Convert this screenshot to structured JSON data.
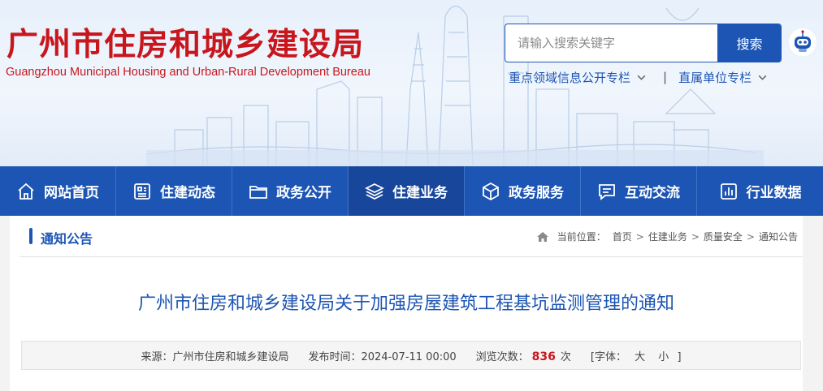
{
  "header": {
    "logo_cn": "广州市住房和城乡建设局",
    "logo_en": "Guangzhou Municipal Housing and Urban-Rural Development Bureau",
    "search_placeholder": "请输入搜索关键字",
    "search_button": "搜索",
    "sublinks": [
      "重点领域信息公开专栏",
      "直属单位专栏"
    ],
    "separator": "|",
    "robot_icon": "robot-assistant-icon"
  },
  "nav": {
    "items": [
      {
        "label": "网站首页",
        "icon": "home-icon"
      },
      {
        "label": "住建动态",
        "icon": "news-icon"
      },
      {
        "label": "政务公开",
        "icon": "folder-icon"
      },
      {
        "label": "住建业务",
        "icon": "layers-icon"
      },
      {
        "label": "政务服务",
        "icon": "box-icon"
      },
      {
        "label": "互动交流",
        "icon": "chat-icon"
      },
      {
        "label": "行业数据",
        "icon": "chart-icon"
      }
    ],
    "active_index": 3
  },
  "section": {
    "title": "通知公告",
    "breadcrumb_label": "当前位置：",
    "breadcrumb": [
      "首页",
      "住建业务",
      "质量安全",
      "通知公告"
    ],
    "breadcrumb_sep": ">"
  },
  "article": {
    "title": "广州市住房和城乡建设局关于加强房屋建筑工程基坑监测管理的通知",
    "source_label": "来源：",
    "source": "广州市住房和城乡建设局",
    "date_label": "发布时间：",
    "date": "2024-07-11 00:00",
    "views_label": "浏览次数：",
    "views": "836",
    "views_unit": "次",
    "font_open": "[字体：",
    "font_large": "大",
    "font_small": "小",
    "font_close": "]"
  },
  "colors": {
    "brand_blue": "#1c55b3",
    "logo_red": "#c8161d",
    "nav_active": "#17469a"
  }
}
